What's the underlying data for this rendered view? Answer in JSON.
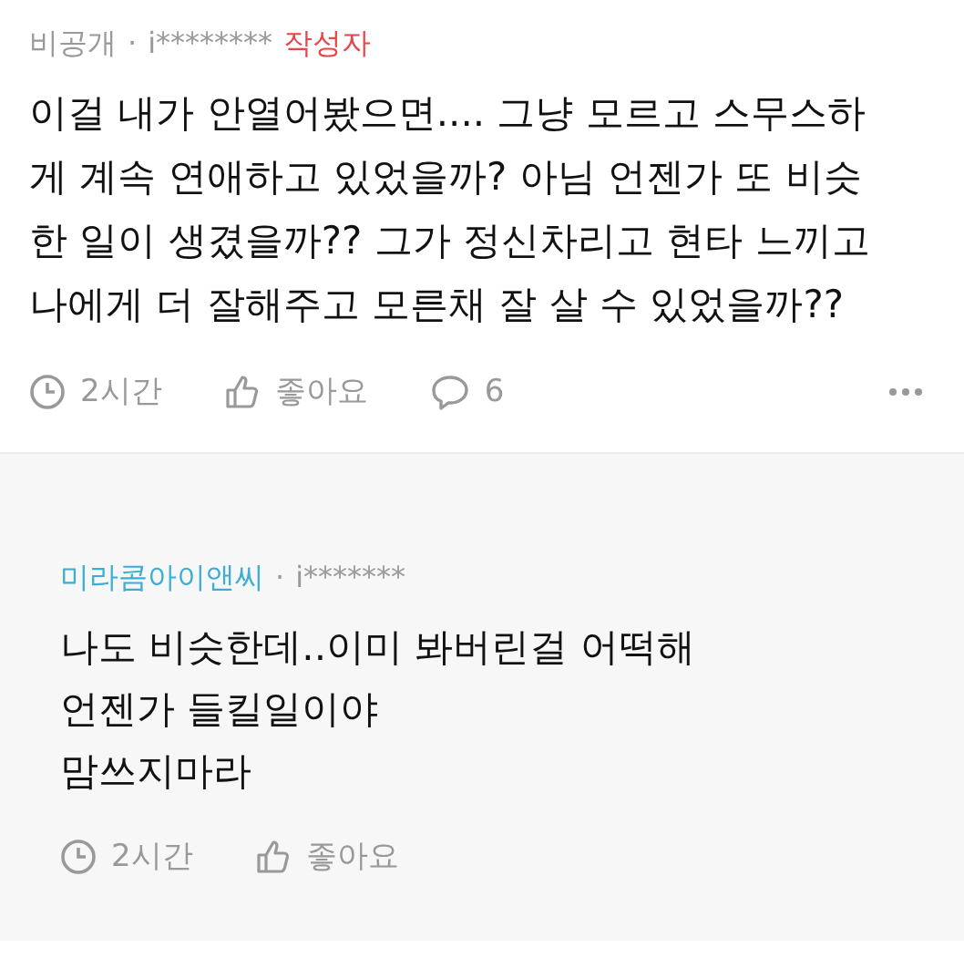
{
  "comment": {
    "author": "비공개",
    "separator": "·",
    "user_id": "i********",
    "badge": "작성자",
    "lines": [
      "이걸 내가 안열어봤으면.... 그냥 모르고 스무스하",
      "게 계속 연애하고 있었을까? 아님 언젠가 또 비슷",
      "한 일이 생겼을까?? 그가 정신차리고 현타 느끼고",
      "나에게 더 잘해주고 모른채 잘 살 수 있었을까??"
    ],
    "time": "2시간",
    "like": "좋아요",
    "replies": "6"
  },
  "reply": {
    "author": "미라콤아이앤씨",
    "separator": "·",
    "user_id": "i*******",
    "lines": [
      "나도 비슷한데..이미 봐버린걸 어떡해",
      "언젠가 들킬일이야",
      "맘쓰지마라"
    ],
    "time": "2시간",
    "like": "좋아요"
  }
}
